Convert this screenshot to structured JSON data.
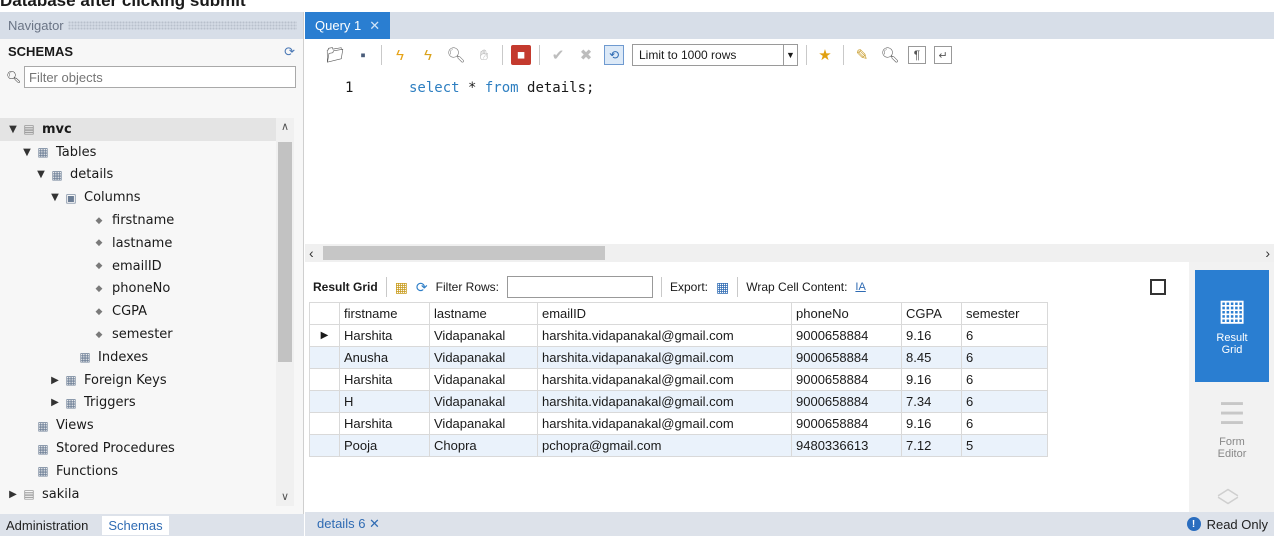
{
  "page_heading": "Database after clicking submit",
  "navigator": {
    "title": "Navigator",
    "schemas_title": "SCHEMAS",
    "filter_placeholder": "Filter objects",
    "tree": [
      {
        "label": "mvc",
        "level": 0,
        "arrow": "▼",
        "icon": "database"
      },
      {
        "label": "Tables",
        "level": 1,
        "arrow": "▼",
        "icon": "folder"
      },
      {
        "label": "details",
        "level": 2,
        "arrow": "▼",
        "icon": "table"
      },
      {
        "label": "Columns",
        "level": 3,
        "arrow": "▼",
        "icon": "columns"
      },
      {
        "label": "firstname",
        "level": 5,
        "arrow": "",
        "icon": "column"
      },
      {
        "label": "lastname",
        "level": 5,
        "arrow": "",
        "icon": "column"
      },
      {
        "label": "emailID",
        "level": 5,
        "arrow": "",
        "icon": "column"
      },
      {
        "label": "phoneNo",
        "level": 5,
        "arrow": "",
        "icon": "column"
      },
      {
        "label": "CGPA",
        "level": 5,
        "arrow": "",
        "icon": "column"
      },
      {
        "label": "semester",
        "level": 5,
        "arrow": "",
        "icon": "column"
      },
      {
        "label": "Indexes",
        "level": 4,
        "arrow": "",
        "icon": "folder"
      },
      {
        "label": "Foreign Keys",
        "level": 3,
        "arrow": "▶",
        "icon": "folder"
      },
      {
        "label": "Triggers",
        "level": 3,
        "arrow": "▶",
        "icon": "folder"
      },
      {
        "label": "Views",
        "level": 1,
        "arrow": "",
        "icon": "folder"
      },
      {
        "label": "Stored Procedures",
        "level": 1,
        "arrow": "",
        "icon": "folder"
      },
      {
        "label": "Functions",
        "level": 1,
        "arrow": "",
        "icon": "folder"
      },
      {
        "label": "sakila",
        "level": 0,
        "arrow": "▶",
        "icon": "database"
      }
    ],
    "tabs": [
      "Administration",
      "Schemas"
    ]
  },
  "main": {
    "query_tab": "Query 1",
    "limit_value": "Limit to 1000 rows",
    "editor": {
      "line_number": "1",
      "kw1": "select",
      "rest1": " * ",
      "kw2": "from",
      "rest2": " details;"
    },
    "result_toolbar": {
      "result_grid": "Result Grid",
      "filter_rows": "Filter Rows:",
      "export": "Export:",
      "wrap": "Wrap Cell Content:"
    },
    "columns": [
      "firstname",
      "lastname",
      "emailID",
      "phoneNo",
      "CGPA",
      "semester"
    ],
    "rows": [
      [
        "Harshita",
        "Vidapanakal",
        "harshita.vidapanakal@gmail.com",
        "9000658884",
        "9.16",
        "6"
      ],
      [
        "Anusha",
        "Vidapanakal",
        "harshita.vidapanakal@gmail.com",
        "9000658884",
        "8.45",
        "6"
      ],
      [
        "Harshita",
        "Vidapanakal",
        "harshita.vidapanakal@gmail.com",
        "9000658884",
        "9.16",
        "6"
      ],
      [
        "H",
        "Vidapanakal",
        "harshita.vidapanakal@gmail.com",
        "9000658884",
        "7.34",
        "6"
      ],
      [
        "Harshita",
        "Vidapanakal",
        "harshita.vidapanakal@gmail.com",
        "9000658884",
        "9.16",
        "6"
      ],
      [
        "Pooja",
        "Chopra",
        "pchopra@gmail.com",
        "9480336613",
        "7.12",
        "5"
      ]
    ],
    "side": {
      "result_grid": "Result\nGrid",
      "form_editor": "Form\nEditor"
    },
    "bottom_tab": "details 6",
    "status": "Read Only"
  }
}
